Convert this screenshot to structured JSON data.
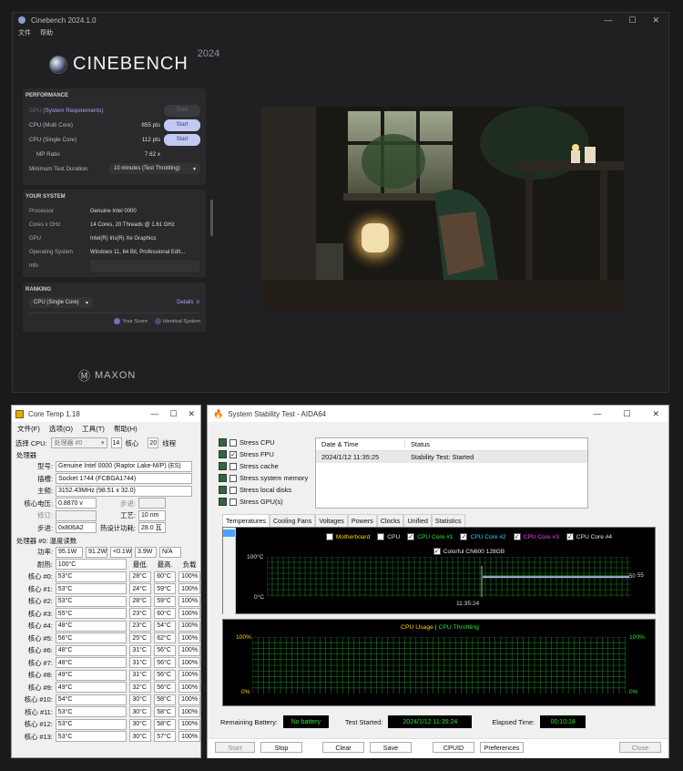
{
  "cinebench": {
    "title": "Cinebench 2024.1.0",
    "menu": [
      "文件",
      "帮助"
    ],
    "logo": "CINEBENCH",
    "year": "2024",
    "performance": {
      "header": "PERFORMANCE",
      "gpu_label": "GPU",
      "gpu_req": "(System Requirements)",
      "gpu_btn": "Start",
      "multi_label": "CPU (Multi Core)",
      "multi_val": "855 pts",
      "multi_btn": "Start",
      "single_label": "CPU (Single Core)",
      "single_val": "112 pts",
      "single_btn": "Start",
      "mp_label": "MP Ratio",
      "mp_val": "7.62 x",
      "min_label": "Minimum Test Duration",
      "min_val": "10 minutes (Test Throttling)"
    },
    "system": {
      "header": "YOUR SYSTEM",
      "rows": [
        {
          "k": "Processor",
          "v": "Genuine Intel 0000"
        },
        {
          "k": "Cores x GHz",
          "v": "14 Cores, 20 Threads @ 1.61 GHz"
        },
        {
          "k": "GPU",
          "v": "Intel(R) Iris(R) Xe Graphics"
        },
        {
          "k": "Operating System",
          "v": "Windows 11, 64 Bit, Professional Edit..."
        },
        {
          "k": "Info",
          "v": ""
        }
      ]
    },
    "ranking": {
      "header": "RANKING",
      "select": "CPU (Single Core)",
      "details": "Details",
      "your_score": "Your Score",
      "identical": "Identical System"
    },
    "maxon": "MAXON"
  },
  "coretemp": {
    "title": "Core Temp 1.18",
    "menu": [
      "文件(F)",
      "选项(O)",
      "工具(T)",
      "帮助(H)"
    ],
    "select_label": "选择 CPU:",
    "select_val": "处理器 #0",
    "cores": "14",
    "cores_label": "核心",
    "threads": "20",
    "threads_label": "线程",
    "proc_header": "处理器",
    "model_label": "型号:",
    "model": "Genuine Intel 0000 (Raptor Lake-M/P)  (ES)",
    "socket_label": "插槽:",
    "socket": "Socket 1744 (FCBGA1744)",
    "freq_label": "主频:",
    "freq": "3152.43MHz (98.51 x 32.0)",
    "vid_label": "核心电压:",
    "vid": "0.8870 v",
    "step_label": "步进:",
    "rev_label": "修订:",
    "lith_label": "工艺:",
    "lith": "10 nm",
    "cpuid_label": "步进:",
    "cpuid": "0x806A2",
    "tdp_label": "热设计功耗:",
    "tdp": "28.0 瓦",
    "temp_header": "处理器 #0: 温度读数",
    "power_label": "功率:",
    "power": [
      "95.1W",
      "91.2W",
      "<0.1W",
      "3.9W",
      "N/A"
    ],
    "tj_label": "耐热:",
    "tj": "100°C",
    "col_min": "最低.",
    "col_max": "最高.",
    "col_load": "负载",
    "cores_rows": [
      {
        "n": "核心 #0:",
        "t": "53°C",
        "min": "28°C",
        "max": "60°C",
        "l": "100%"
      },
      {
        "n": "核心 #1:",
        "t": "53°C",
        "min": "24°C",
        "max": "59°C",
        "l": "100%"
      },
      {
        "n": "核心 #2:",
        "t": "53°C",
        "min": "28°C",
        "max": "59°C",
        "l": "100%"
      },
      {
        "n": "核心 #3:",
        "t": "55°C",
        "min": "23°C",
        "max": "60°C",
        "l": "100%"
      },
      {
        "n": "核心 #4:",
        "t": "48°C",
        "min": "23°C",
        "max": "54°C",
        "l": "100%"
      },
      {
        "n": "核心 #5:",
        "t": "56°C",
        "min": "25°C",
        "max": "62°C",
        "l": "100%"
      },
      {
        "n": "核心 #6:",
        "t": "48°C",
        "min": "31°C",
        "max": "56°C",
        "l": "100%"
      },
      {
        "n": "核心 #7:",
        "t": "48°C",
        "min": "31°C",
        "max": "56°C",
        "l": "100%"
      },
      {
        "n": "核心 #8:",
        "t": "49°C",
        "min": "31°C",
        "max": "56°C",
        "l": "100%"
      },
      {
        "n": "核心 #9:",
        "t": "49°C",
        "min": "32°C",
        "max": "56°C",
        "l": "100%"
      },
      {
        "n": "核心 #10:",
        "t": "54°C",
        "min": "30°C",
        "max": "58°C",
        "l": "100%"
      },
      {
        "n": "核心 #11:",
        "t": "53°C",
        "min": "30°C",
        "max": "58°C",
        "l": "100%"
      },
      {
        "n": "核心 #12:",
        "t": "53°C",
        "min": "30°C",
        "max": "58°C",
        "l": "100%"
      },
      {
        "n": "核心 #13:",
        "t": "53°C",
        "min": "30°C",
        "max": "57°C",
        "l": "100%"
      }
    ]
  },
  "aida": {
    "title": "System Stability Test - AIDA64",
    "stress": [
      {
        "label": "Stress CPU",
        "checked": false
      },
      {
        "label": "Stress FPU",
        "checked": true
      },
      {
        "label": "Stress cache",
        "checked": false
      },
      {
        "label": "Stress system memory",
        "checked": false
      },
      {
        "label": "Stress local disks",
        "checked": false
      },
      {
        "label": "Stress GPU(s)",
        "checked": false
      }
    ],
    "log_cols": [
      "Date & Time",
      "Status"
    ],
    "log_rows": [
      {
        "dt": "2024/1/12 11:35:25",
        "st": "Stability Test: Started"
      }
    ],
    "tabs": [
      "Temperatures",
      "Cooling Fans",
      "Voltages",
      "Powers",
      "Clocks",
      "Unified",
      "Statistics"
    ],
    "legend": [
      {
        "label": "Motherboard",
        "checked": false,
        "color": "#ffd400"
      },
      {
        "label": "CPU",
        "checked": false,
        "color": "#e8e8e8"
      },
      {
        "label": "CPU Core #1",
        "checked": true,
        "color": "#2fe233"
      },
      {
        "label": "CPU Core #2",
        "checked": true,
        "color": "#35d6ff"
      },
      {
        "label": "CPU Core #3",
        "checked": true,
        "color": "#ff3cff"
      },
      {
        "label": "CPU Core #4",
        "checked": true,
        "color": "#e8e8e8"
      },
      {
        "label": "Colorful CN600 128GB",
        "checked": true,
        "color": "#e8e8e8"
      }
    ],
    "temp_top": "100°C",
    "temp_bottom": "0°C",
    "temp_time": "11:35:24",
    "temp_val1": "50",
    "temp_val2": "55",
    "usage_title_a": "CPU Usage",
    "usage_sep": "|",
    "usage_title_b": "CPU Throttling",
    "usage_top_l": "100%",
    "usage_bot_l": "0%",
    "usage_top_r": "100%",
    "usage_bot_r": "0%",
    "battery_label": "Remaining Battery:",
    "battery": "No battery",
    "started_label": "Test Started:",
    "started": "2024/1/12 11:35:24",
    "elapsed_label": "Elapsed Time:",
    "elapsed": "00:10:18",
    "buttons": {
      "start": "Start",
      "stop": "Stop",
      "clear": "Clear",
      "save": "Save",
      "cpuid": "CPUID",
      "prefs": "Preferences",
      "close": "Close"
    }
  }
}
